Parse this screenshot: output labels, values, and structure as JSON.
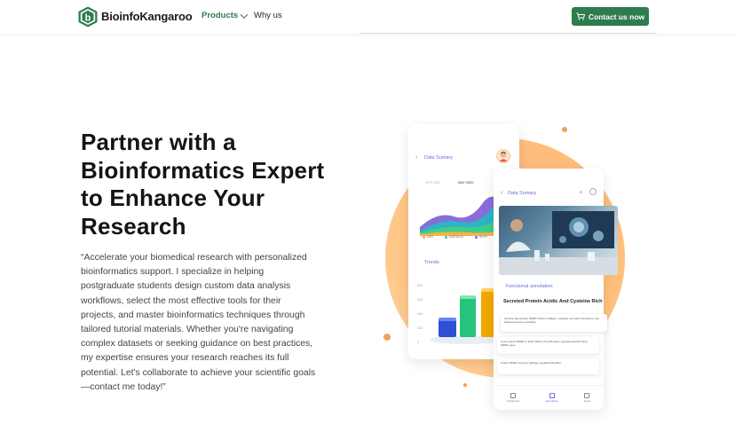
{
  "header": {
    "brand": "BioinfoKangaroo",
    "nav": {
      "products": "Products",
      "why_us": "Why us"
    },
    "cta": "Contact us now",
    "logo_icon": "hexagon-b-logo",
    "cart_icon": "cart-icon"
  },
  "hero": {
    "title": "Partner with a Bioinformatics Expert to Enhance Your Research",
    "description": "“Accelerate your biomedical research with personalized bioinformatics support. I specialize in helping postgraduate students design custom data analysis workflows, select the most effective tools for their projects, and master bioinformatics techniques through tailored tutorial materials. Whether you're navigating complex datasets or seeking guidance on best practices, my expertise ensures your research reaches its full potential. Let's collaborate to achieve your scientific goals—contact me today!”"
  },
  "illustration": {
    "back_card": {
      "title": "Data Sumary",
      "months": [
        "APR 2020",
        "MAY 2020"
      ],
      "legend": [
        "MAY",
        "AVERAGE",
        "HIGH"
      ],
      "trends_label": "Trends",
      "trend_axis": [
        "800",
        "600",
        "400",
        "200",
        "0"
      ]
    },
    "front_card": {
      "title": "Data Sumary",
      "section": "Functional annotation",
      "protein": "Secreted Protein Acidic And Cysteine Rich",
      "notes": [
        "Secreted glycoprotein SPARC binds to collagen, regulates cell-matrix interactions, and influences tissue remodeling.",
        "Gene product SPARC in ECM. Matrix cell proliferation. Hypoxia-inducible factor SPARC gene",
        "Protein SPARC secretory pathway regulation fibroblast"
      ],
      "tabs": [
        "Dashboard",
        "Standards",
        "Alerts"
      ]
    },
    "colors": {
      "accent": "#2e7c4d",
      "blob": "#ffbe7a",
      "violet": "#6a6fd8"
    }
  }
}
